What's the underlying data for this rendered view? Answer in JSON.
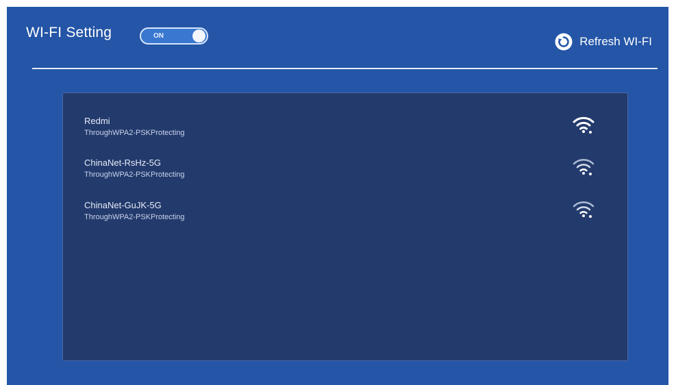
{
  "header": {
    "title": "WI-FI Setting",
    "toggle_label": "ON",
    "refresh_label": "Refresh WI-FI"
  },
  "networks": [
    {
      "name": "Redmi",
      "security": "ThroughWPA2-PSKProtecting",
      "icon": "wifi-signal-full-icon"
    },
    {
      "name": "ChinaNet-RsHz-5G",
      "security": "ThroughWPA2-PSKProtecting",
      "icon": "wifi-signal-icon"
    },
    {
      "name": "ChinaNet-GuJK-5G",
      "security": "ThroughWPA2-PSKProtecting",
      "icon": "wifi-signal-icon"
    }
  ],
  "colors": {
    "background": "#2455a7",
    "panel": "#233a6c",
    "toggle": "#3a77d0",
    "text": "#ffffff"
  }
}
